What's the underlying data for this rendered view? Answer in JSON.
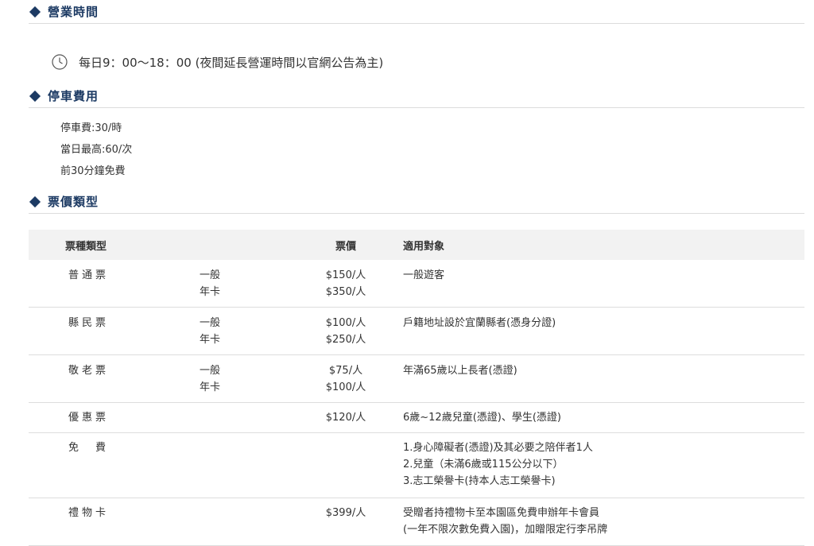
{
  "sections": {
    "hours": {
      "title": "營業時間",
      "text": "每日9：00～18：00 (夜間延長營運時間以官網公告為主)"
    },
    "parking": {
      "title": "停車費用",
      "lines": [
        "停車費:30/時",
        "當日最高:60/次",
        "前30分鐘免費"
      ]
    },
    "tickets": {
      "title": "票價類型"
    }
  },
  "ticket_table": {
    "headers": {
      "type": "票種類型",
      "price": "票價",
      "target": "適用對象"
    },
    "rows": [
      {
        "type": "普通票",
        "kinds": [
          "一般",
          "年卡"
        ],
        "prices": [
          "$150/人",
          "$350/人"
        ],
        "targets": [
          "一般遊客"
        ]
      },
      {
        "type": "縣民票",
        "kinds": [
          "一般",
          "年卡"
        ],
        "prices": [
          "$100/人",
          "$250/人"
        ],
        "targets": [
          "戶籍地址設於宜蘭縣者(憑身分證)"
        ]
      },
      {
        "type": "敬老票",
        "kinds": [
          "一般",
          "年卡"
        ],
        "prices": [
          "$75/人",
          "$100/人"
        ],
        "targets": [
          "年滿65歲以上長者(憑證)"
        ]
      },
      {
        "type": "優惠票",
        "kinds": [],
        "prices": [
          "$120/人"
        ],
        "targets": [
          "6歲~12歲兒童(憑證)、學生(憑證)"
        ]
      },
      {
        "type": "免　費",
        "kinds": [],
        "prices": [],
        "targets": [
          "1.身心障礙者(憑證)及其必要之陪伴者1人",
          "2.兒童（未滿6歲或115公分以下）",
          "3.志工榮譽卡(持本人志工榮譽卡)"
        ]
      },
      {
        "type": "禮物卡",
        "kinds": [],
        "prices": [
          "$399/人"
        ],
        "targets": [
          "受贈者持禮物卡至本園區免費申辦年卡會員",
          "(一年不限次數免費入園)，加贈限定行李吊牌"
        ]
      }
    ]
  },
  "colors": {
    "accent": "#1c3a63",
    "header_bg": "#f2f2f2",
    "text": "#333333"
  },
  "icons": {
    "hours": "clock-icon",
    "section_marker": "diamond-icon"
  }
}
